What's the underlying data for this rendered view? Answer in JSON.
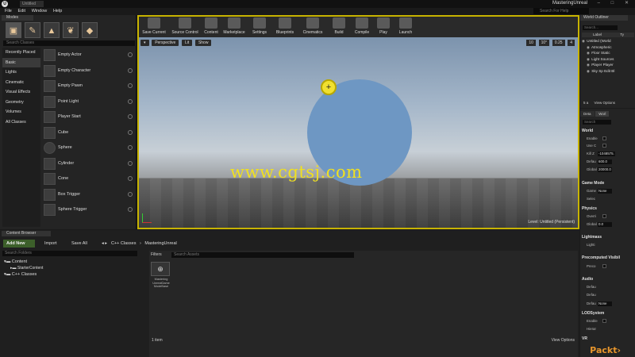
{
  "titlebar": {
    "logo": "U",
    "level_tab": "Untitled",
    "project": "MasteringUnreal",
    "window_controls": "– □ ✕",
    "help_search": "Search For Help"
  },
  "menu": [
    "File",
    "Edit",
    "Window",
    "Help"
  ],
  "modes": {
    "tab": "Modes",
    "tools": [
      "place-icon",
      "paint-icon",
      "landscape-icon",
      "foliage-icon",
      "geometry-icon"
    ],
    "search_placeholder": "Search Classes",
    "categories": [
      "Recently Placed",
      "Basic",
      "Lights",
      "Cinematic",
      "Visual Effects",
      "Geometry",
      "Volumes",
      "All Classes"
    ],
    "active_category": "Basic",
    "items": [
      "Empty Actor",
      "Empty Character",
      "Empty Pawn",
      "Point Light",
      "Player Start",
      "Cube",
      "Sphere",
      "Cylinder",
      "Cone",
      "Box Trigger",
      "Sphere Trigger"
    ]
  },
  "toolbar": {
    "buttons": [
      "Save Current",
      "Source Control",
      "Content",
      "Marketplace",
      "Settings",
      "Blueprints",
      "Cinematics",
      "Build",
      "Compile",
      "Play",
      "Launch"
    ]
  },
  "viewport": {
    "perspective": "Perspective",
    "lit": "Lit",
    "show": "Show",
    "grid_snap": "10",
    "rotation_snap": "10°",
    "scale_snap": "0.25",
    "camera_speed": "4",
    "level_label": "Level:  Untitled (Persistent)",
    "watermark": "www.cgtsj.com",
    "cursor_glyph": "+"
  },
  "outliner": {
    "tab": "World Outliner",
    "search_placeholder": "Search...",
    "col_label": "Label",
    "col_type": "Ty",
    "rows": [
      "Untitled (World",
      "Atmospheric",
      "Floor  Static",
      "Light Sources",
      "Player  Player",
      "Sky Sp  Edit Bl"
    ],
    "footer": "5 a",
    "view_options": "View Options"
  },
  "details": {
    "tabs": [
      "Deta",
      "Worl"
    ],
    "search_placeholder": "Search",
    "sections": {
      "world": "World",
      "game_mode": "Game Mode",
      "physics": "Physics",
      "lightmass": "Lightmass",
      "precomputed": "Precomputed Visibil",
      "audio": "Audio",
      "lod": "LODSystem",
      "vr": "VR"
    },
    "props": {
      "enable": "Enable",
      "use_c": "Use C",
      "kill_z": "Kill Z",
      "kill_z_val": "-1048575.",
      "default": "Defau",
      "default_val": "600.0",
      "global": "Global",
      "global_val": "20000.0",
      "game_mode_label": "Game",
      "game_mode_val": "None",
      "selected": "Selec",
      "override": "Overri",
      "global_grav": "Global",
      "global_grav_val": "0.0",
      "lighting": "Lighti",
      "preco": "Preco",
      "audio_default1": "Defau",
      "audio_default2": "Defau",
      "audio_default3": "Defau",
      "audio_default3_val": "None",
      "lod_enable": "Enable",
      "hierarchical": "Hierar"
    }
  },
  "content_browser": {
    "tab": "Content Browser",
    "add_new": "Add New",
    "import": "Import",
    "save_all": "Save All",
    "path": [
      "C++ Classes",
      "MasteringUnreal"
    ],
    "search_folders": "Search Folders",
    "tree": [
      "Content",
      "StarterContent",
      "C++ Classes"
    ],
    "filters": "Filters",
    "search_assets": "Search Assets",
    "asset_name": "Mastering UnrealGame ModeBase",
    "item_count": "1 item",
    "view_options": "View Options"
  },
  "branding": "Packt›"
}
